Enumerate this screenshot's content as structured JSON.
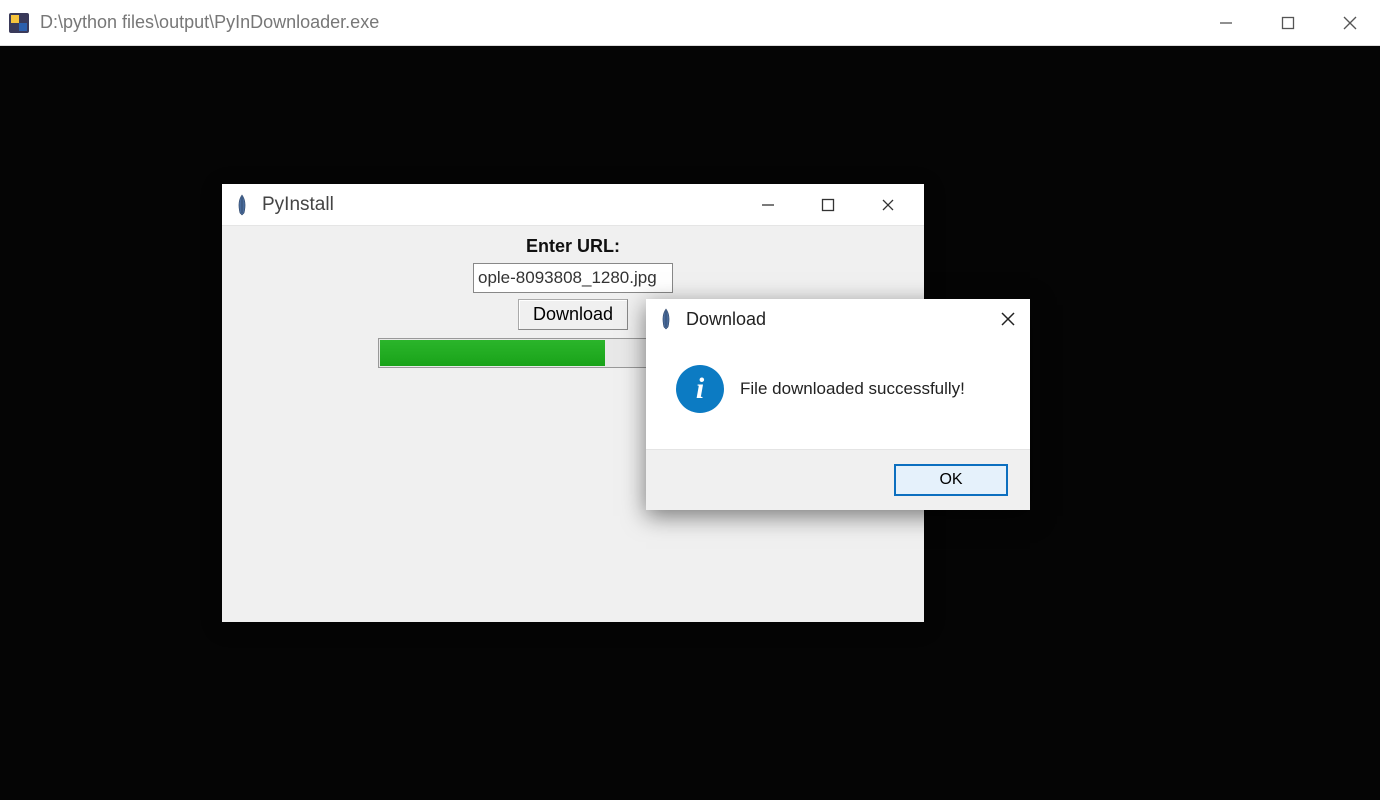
{
  "outerWindow": {
    "title": "D:\\python files\\output\\PyInDownloader.exe"
  },
  "pyinstall": {
    "title": "PyInstall",
    "urlLabel": "Enter URL:",
    "urlValue": "ople-8093808_1280.jpg",
    "downloadLabel": "Download"
  },
  "dialog": {
    "title": "Download",
    "message": "File downloaded successfully!",
    "okLabel": "OK"
  }
}
